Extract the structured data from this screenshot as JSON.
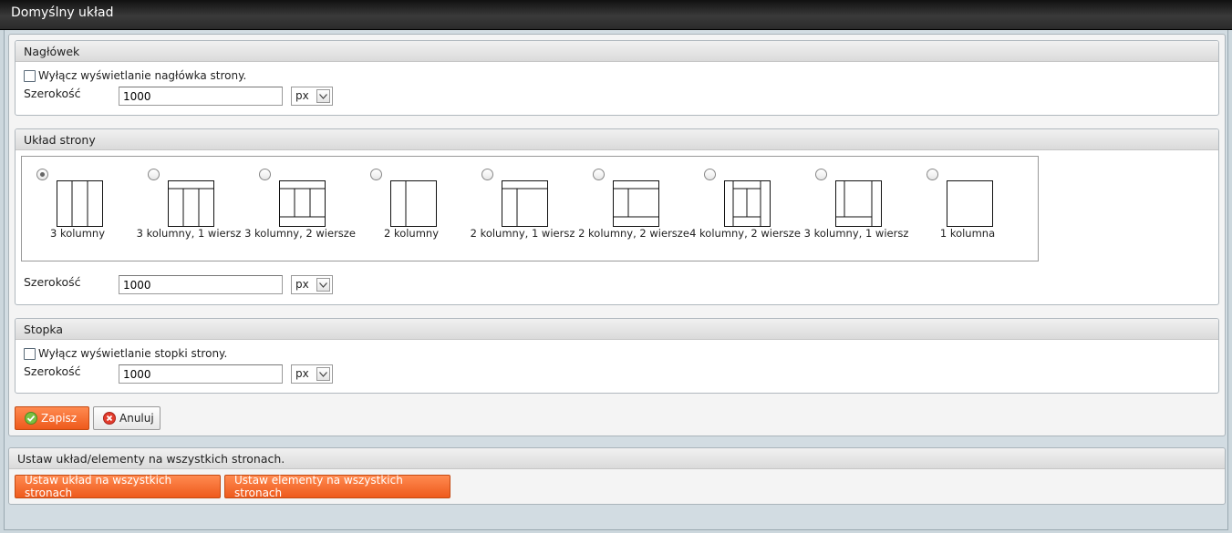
{
  "window": {
    "title": "Domyślny układ"
  },
  "header_section": {
    "title": "Nagłówek",
    "checkbox_label": "Wyłącz wyświetlanie nagłówka strony.",
    "width_label": "Szerokość",
    "width_value": "1000",
    "unit": "px"
  },
  "layout_section": {
    "title": "Układ strony",
    "width_label": "Szerokość",
    "width_value": "1000",
    "unit": "px",
    "options": [
      {
        "label": "3 kolumny",
        "selected": true
      },
      {
        "label": "3 kolumny, 1 wiersz",
        "selected": false
      },
      {
        "label": "3 kolumny, 2 wiersze",
        "selected": false
      },
      {
        "label": "2 kolumny",
        "selected": false
      },
      {
        "label": "2 kolumny, 1 wiersz",
        "selected": false
      },
      {
        "label": "2 kolumny, 2 wiersze",
        "selected": false
      },
      {
        "label": "4 kolumny, 2 wiersze",
        "selected": false
      },
      {
        "label": "3 kolumny, 1 wiersz",
        "selected": false
      },
      {
        "label": "1 kolumna",
        "selected": false
      }
    ]
  },
  "footer_section": {
    "title": "Stopka",
    "checkbox_label": "Wyłącz wyświetlanie stopki strony.",
    "width_label": "Szerokość",
    "width_value": "1000",
    "unit": "px"
  },
  "actions": {
    "save_label": "Zapisz",
    "cancel_label": "Anuluj"
  },
  "global_section": {
    "title": "Ustaw układ/elementy na wszystkich stronach.",
    "apply_layout_label": "Ustaw układ na wszystkich stronach",
    "apply_elements_label": "Ustaw elementy na wszystkich stronach"
  },
  "colors": {
    "accent": "#f26a2e",
    "title_bar": "#2b2b2b",
    "background": "#ccd7dd"
  }
}
